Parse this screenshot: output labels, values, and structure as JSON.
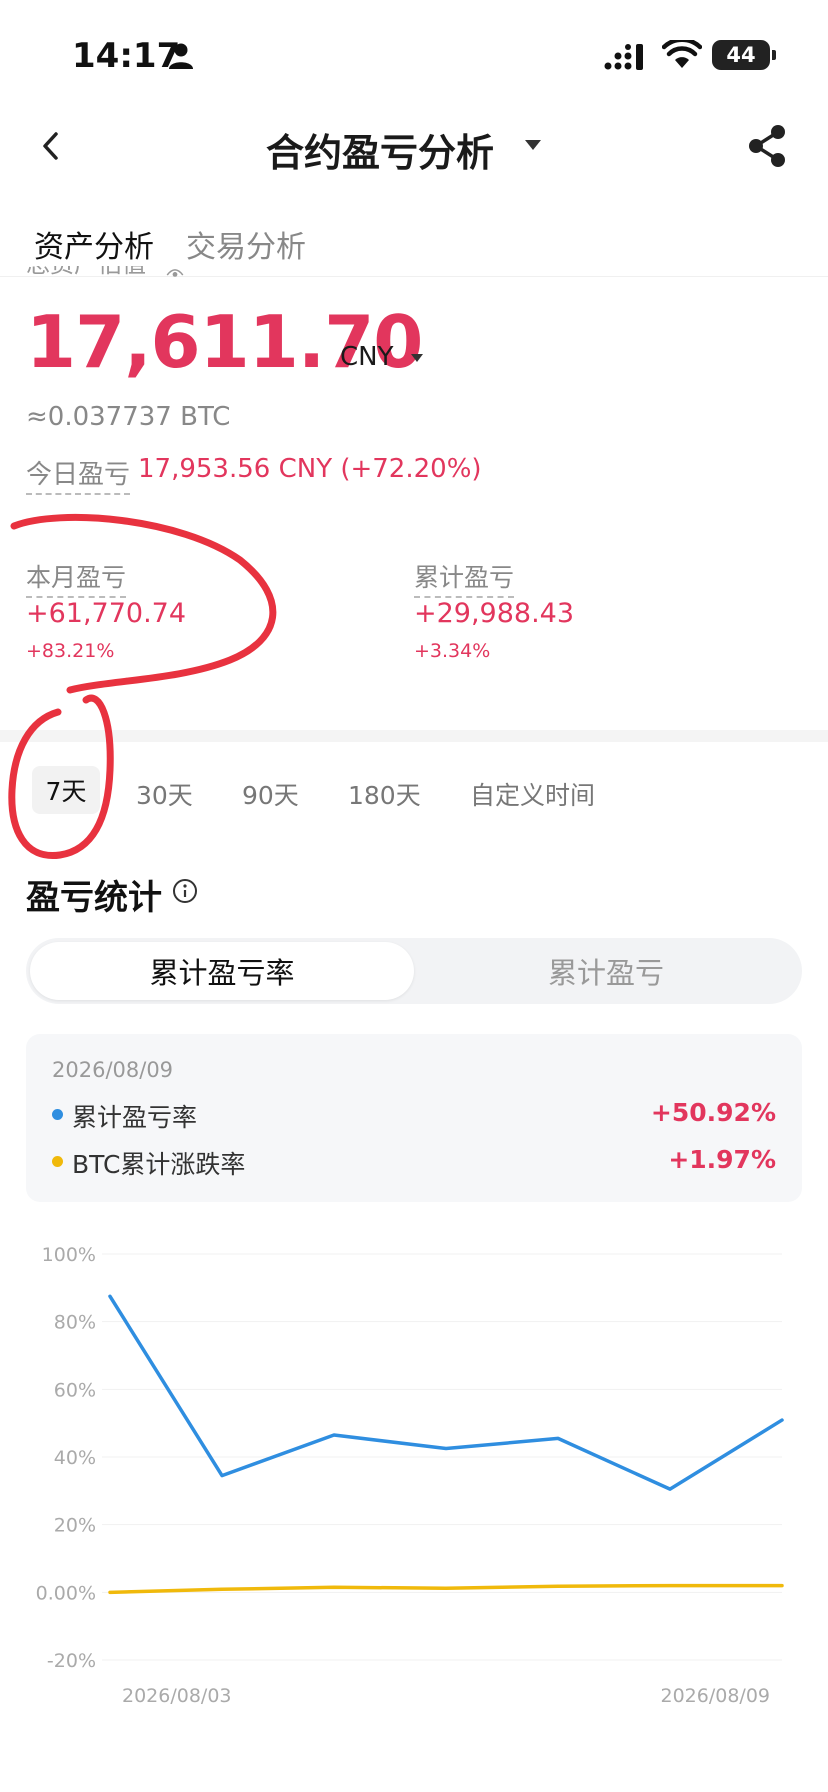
{
  "status_bar": {
    "time": "14:17",
    "battery": "44"
  },
  "nav": {
    "title": "合约盈亏分析"
  },
  "tabs": [
    {
      "label": "资产分析",
      "active": true
    },
    {
      "label": "交易分析",
      "active": false
    }
  ],
  "asset": {
    "label_partial": "总资产估值",
    "value": "17,611.70",
    "unit": "CNY",
    "btc_equiv": "≈0.037737 BTC",
    "today_label": "今日盈亏",
    "today_value": "17,953.56 CNY (+72.20%)"
  },
  "stats": {
    "month": {
      "label": "本月盈亏",
      "value": "+61,770.74",
      "pct": "+83.21%"
    },
    "total": {
      "label": "累计盈亏",
      "value": "+29,988.43",
      "pct": "+3.34%"
    }
  },
  "ranges": [
    "7天",
    "30天",
    "90天",
    "180天",
    "自定义时间"
  ],
  "selected_range": "7天",
  "section_title": "盈亏统计",
  "segment": {
    "active": "累计盈亏率",
    "inactive": "累计盈亏"
  },
  "tooltip": {
    "date": "2026/08/09",
    "rows": [
      {
        "label": "累计盈亏率",
        "value": "+50.92%",
        "color": "#2f8ee0"
      },
      {
        "label": "BTC累计涨跌率",
        "value": "+1.97%",
        "color": "#f0b90b"
      }
    ]
  },
  "colors": {
    "accent_red": "#e2365d",
    "series_blue": "#2f8ee0",
    "series_yellow": "#f0b90b",
    "annotation": "#e8323f"
  },
  "chart_data": {
    "type": "line",
    "x": [
      "2026/08/03",
      "2026/08/04",
      "2026/08/05",
      "2026/08/06",
      "2026/08/07",
      "2026/08/08",
      "2026/08/09"
    ],
    "x_tick_labels": [
      "2026/08/03",
      "2026/08/09"
    ],
    "y_tick_labels": [
      "100%",
      "80%",
      "60%",
      "40%",
      "20%",
      "0.00%",
      "-20%"
    ],
    "ylim": [
      -20,
      100
    ],
    "grid": true,
    "series": [
      {
        "name": "累计盈亏率",
        "color": "#2f8ee0",
        "values": [
          87.5,
          34.5,
          46.5,
          42.5,
          45.5,
          30.5,
          50.92
        ]
      },
      {
        "name": "BTC累计涨跌率",
        "color": "#f0b90b",
        "values": [
          0.0,
          0.9,
          1.5,
          1.2,
          1.8,
          2.0,
          1.97
        ]
      }
    ]
  }
}
